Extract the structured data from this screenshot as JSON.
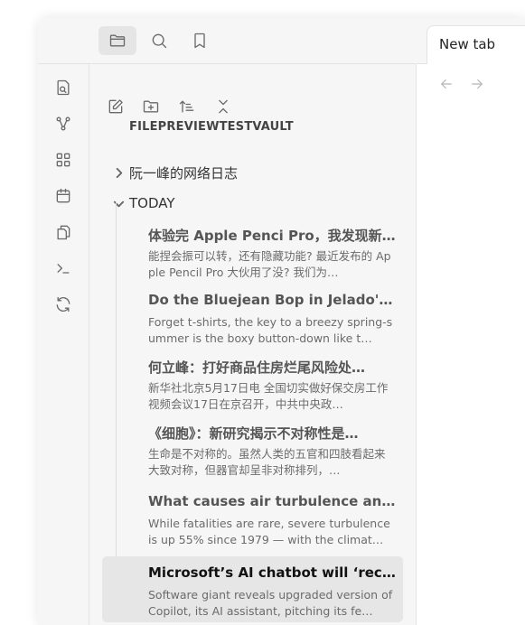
{
  "vault_name": "FILEPREVIEWTESTVAULT",
  "folders": [
    {
      "label": "阮一峰的网络日志",
      "expanded": false
    },
    {
      "label": "TODAY",
      "expanded": true
    }
  ],
  "files": [
    {
      "title": "体验完 Apple Penci Pro，我发现新…",
      "preview": "能捏会振可以转，还有隐藏功能? 最近发布的 Apple Pencil Pro 大伙用了没? 我们为…"
    },
    {
      "title": "Do the Bluejean Bop in Jelado's…",
      "preview": "Forget t-shirts, the key to a breezy spring-summer is the boxy button-down like t…"
    },
    {
      "title": "何立峰：打好商品住房烂尾风险处…",
      "preview": "新华社北京5月17日电 全国切实做好保交房工作视频会议17日在京召开，中共中央政…"
    },
    {
      "title": "《细胞》：新研究揭示不对称性是…",
      "preview": "生命是不对称的。虽然人类的五官和四肢看起来大致对称，但器官却呈非对称排列，…"
    },
    {
      "title": "What causes air turbulence and i…",
      "preview": "While fatalities are rare, severe turbulence is up 55% since 1979 — with the climat…"
    },
    {
      "title": "Microsoft’s AI chatbot will ‘recal…",
      "preview": "Software giant reveals upgraded version of Copilot, its AI assistant, pitching its fe…",
      "active": true
    }
  ],
  "tab": {
    "label": "New tab"
  },
  "icons": {
    "toggle_sidebar": "sidebar-toggle-icon",
    "files_tab": "folder-icon",
    "search_tab": "search-icon",
    "bookmarks_tab": "bookmark-icon",
    "new_note": "edit-icon",
    "new_folder": "folder-plus-icon",
    "sort": "sort-icon",
    "collapse": "collapse-icon"
  }
}
